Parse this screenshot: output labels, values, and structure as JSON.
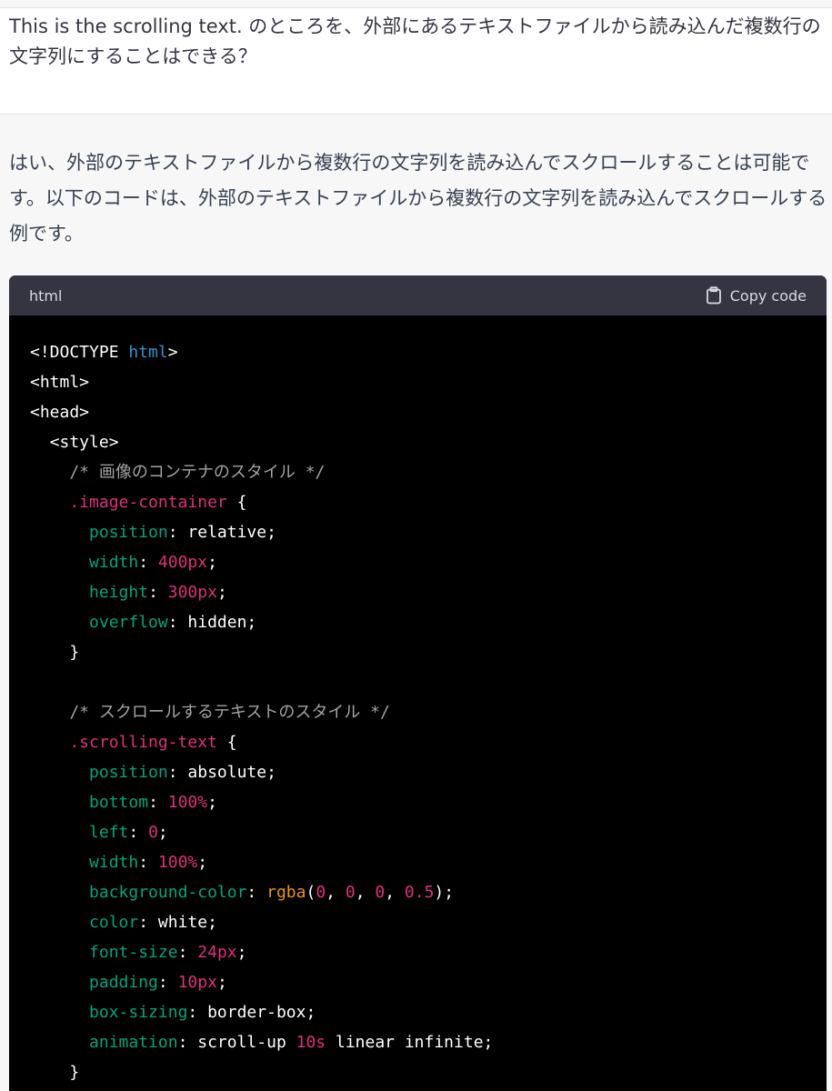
{
  "user_message": {
    "text": "This is the scrolling text. のところを、外部にあるテキストファイルから読み込んだ複数行の文字列にすることはできる？"
  },
  "assistant_message": {
    "text": "はい、外部のテキストファイルから複数行の文字列を読み込んでスクロールすることは可能です。以下のコードは、外部のテキストファイルから複数行の文字列を読み込んでスクロールする例です。"
  },
  "code_block": {
    "language": "html",
    "copy_label": "Copy code",
    "copy_icon": "clipboard-icon",
    "colors": {
      "header_bg": "#343541",
      "body_bg": "#000000",
      "keyword": "#2e95d3",
      "comment": "#a3a3a3",
      "selector": "#df3079",
      "property": "#00a67d",
      "number": "#df3079",
      "function": "#e9950c"
    },
    "lines": [
      [
        {
          "t": "<!DOCTYPE ",
          "c": "plain"
        },
        {
          "t": "html",
          "c": "keyword"
        },
        {
          "t": ">",
          "c": "plain"
        }
      ],
      [
        {
          "t": "<html>",
          "c": "plain"
        }
      ],
      [
        {
          "t": "<head>",
          "c": "plain"
        }
      ],
      [
        {
          "t": "  <style>",
          "c": "plain"
        }
      ],
      [
        {
          "t": "    /* 画像のコンテナのスタイル */",
          "c": "comment"
        }
      ],
      [
        {
          "t": "    .image-container",
          "c": "selector"
        },
        {
          "t": " {",
          "c": "plain"
        }
      ],
      [
        {
          "t": "      ",
          "c": "plain"
        },
        {
          "t": "position",
          "c": "property"
        },
        {
          "t": ": relative;",
          "c": "plain"
        }
      ],
      [
        {
          "t": "      ",
          "c": "plain"
        },
        {
          "t": "width",
          "c": "property"
        },
        {
          "t": ": ",
          "c": "plain"
        },
        {
          "t": "400px",
          "c": "number"
        },
        {
          "t": ";",
          "c": "plain"
        }
      ],
      [
        {
          "t": "      ",
          "c": "plain"
        },
        {
          "t": "height",
          "c": "property"
        },
        {
          "t": ": ",
          "c": "plain"
        },
        {
          "t": "300px",
          "c": "number"
        },
        {
          "t": ";",
          "c": "plain"
        }
      ],
      [
        {
          "t": "      ",
          "c": "plain"
        },
        {
          "t": "overflow",
          "c": "property"
        },
        {
          "t": ": hidden;",
          "c": "plain"
        }
      ],
      [
        {
          "t": "    }",
          "c": "plain"
        }
      ],
      [
        {
          "t": "",
          "c": "plain"
        }
      ],
      [
        {
          "t": "    /* スクロールするテキストのスタイル */",
          "c": "comment"
        }
      ],
      [
        {
          "t": "    .scrolling-text",
          "c": "selector"
        },
        {
          "t": " {",
          "c": "plain"
        }
      ],
      [
        {
          "t": "      ",
          "c": "plain"
        },
        {
          "t": "position",
          "c": "property"
        },
        {
          "t": ": absolute;",
          "c": "plain"
        }
      ],
      [
        {
          "t": "      ",
          "c": "plain"
        },
        {
          "t": "bottom",
          "c": "property"
        },
        {
          "t": ": ",
          "c": "plain"
        },
        {
          "t": "100%",
          "c": "number"
        },
        {
          "t": ";",
          "c": "plain"
        }
      ],
      [
        {
          "t": "      ",
          "c": "plain"
        },
        {
          "t": "left",
          "c": "property"
        },
        {
          "t": ": ",
          "c": "plain"
        },
        {
          "t": "0",
          "c": "number"
        },
        {
          "t": ";",
          "c": "plain"
        }
      ],
      [
        {
          "t": "      ",
          "c": "plain"
        },
        {
          "t": "width",
          "c": "property"
        },
        {
          "t": ": ",
          "c": "plain"
        },
        {
          "t": "100%",
          "c": "number"
        },
        {
          "t": ";",
          "c": "plain"
        }
      ],
      [
        {
          "t": "      ",
          "c": "plain"
        },
        {
          "t": "background-color",
          "c": "property"
        },
        {
          "t": ": ",
          "c": "plain"
        },
        {
          "t": "rgba",
          "c": "function"
        },
        {
          "t": "(",
          "c": "plain"
        },
        {
          "t": "0",
          "c": "number"
        },
        {
          "t": ", ",
          "c": "plain"
        },
        {
          "t": "0",
          "c": "number"
        },
        {
          "t": ", ",
          "c": "plain"
        },
        {
          "t": "0",
          "c": "number"
        },
        {
          "t": ", ",
          "c": "plain"
        },
        {
          "t": "0.5",
          "c": "number"
        },
        {
          "t": ");",
          "c": "plain"
        }
      ],
      [
        {
          "t": "      ",
          "c": "plain"
        },
        {
          "t": "color",
          "c": "property"
        },
        {
          "t": ": white;",
          "c": "plain"
        }
      ],
      [
        {
          "t": "      ",
          "c": "plain"
        },
        {
          "t": "font-size",
          "c": "property"
        },
        {
          "t": ": ",
          "c": "plain"
        },
        {
          "t": "24px",
          "c": "number"
        },
        {
          "t": ";",
          "c": "plain"
        }
      ],
      [
        {
          "t": "      ",
          "c": "plain"
        },
        {
          "t": "padding",
          "c": "property"
        },
        {
          "t": ": ",
          "c": "plain"
        },
        {
          "t": "10px",
          "c": "number"
        },
        {
          "t": ";",
          "c": "plain"
        }
      ],
      [
        {
          "t": "      ",
          "c": "plain"
        },
        {
          "t": "box-sizing",
          "c": "property"
        },
        {
          "t": ": border-box;",
          "c": "plain"
        }
      ],
      [
        {
          "t": "      ",
          "c": "plain"
        },
        {
          "t": "animation",
          "c": "property"
        },
        {
          "t": ": scroll-up ",
          "c": "plain"
        },
        {
          "t": "10s",
          "c": "number"
        },
        {
          "t": " linear infinite;",
          "c": "plain"
        }
      ],
      [
        {
          "t": "    }",
          "c": "plain"
        }
      ]
    ]
  }
}
